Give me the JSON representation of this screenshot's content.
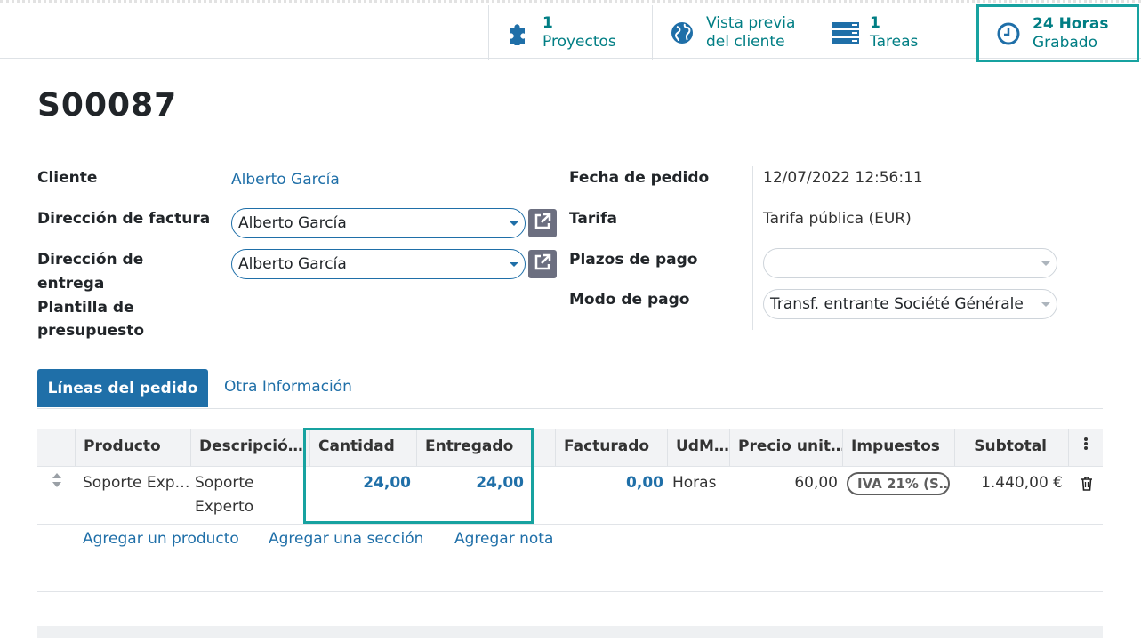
{
  "stat_buttons": [
    {
      "value": "1",
      "label": "Proyectos",
      "icon": "puzzle-icon"
    },
    {
      "value": "Vista previa",
      "label": "del cliente",
      "icon": "globe-icon"
    },
    {
      "value": "1",
      "label": "Tareas",
      "icon": "tasks-icon"
    },
    {
      "value": "24 Horas",
      "label": "Grabado",
      "icon": "clock-icon"
    }
  ],
  "record": {
    "name": "S00087"
  },
  "form": {
    "cliente_label": "Cliente",
    "cliente_value": "Alberto García",
    "direccion_factura_label": "Dirección de factura",
    "direccion_factura_value": "Alberto García",
    "direccion_entrega_label_1": "Dirección de",
    "direccion_entrega_label_2": "entrega",
    "direccion_entrega_value": "Alberto García",
    "plantilla_label_1": "Plantilla de",
    "plantilla_label_2": "presupuesto",
    "fecha_label": "Fecha de pedido",
    "fecha_value": "12/07/2022 12:56:11",
    "tarifa_label": "Tarifa",
    "tarifa_value": "Tarifa pública (EUR)",
    "plazos_label": "Plazos de pago",
    "plazos_value": "",
    "modo_label": "Modo de pago",
    "modo_value": "Transf. entrante Société Générale"
  },
  "tabs": {
    "active": "Líneas del pedido",
    "other": "Otra Información"
  },
  "table": {
    "headers": {
      "producto": "Producto",
      "descripcion": "Descripció…",
      "cantidad": "Cantidad",
      "entregado": "Entregado",
      "facturado": "Facturado",
      "udm": "UdM…",
      "precio": "Precio unit…",
      "impuestos": "Impuestos",
      "subtotal": "Subtotal"
    },
    "row": {
      "producto": "Soporte Exp…",
      "descripcion_1": "Soporte",
      "descripcion_2": "Experto",
      "cantidad": "24,00",
      "entregado": "24,00",
      "facturado": "0,00",
      "udm": "Horas",
      "precio": "60,00",
      "impuestos": "IVA 21% (S…",
      "subtotal": "1.440,00 €"
    },
    "add_links": {
      "producto": "Agregar un producto",
      "seccion": "Agregar una sección",
      "nota": "Agregar nota"
    }
  },
  "colors": {
    "accent": "#1f6fa8",
    "stat_text": "#017e84",
    "highlight": "#17a2a0"
  }
}
